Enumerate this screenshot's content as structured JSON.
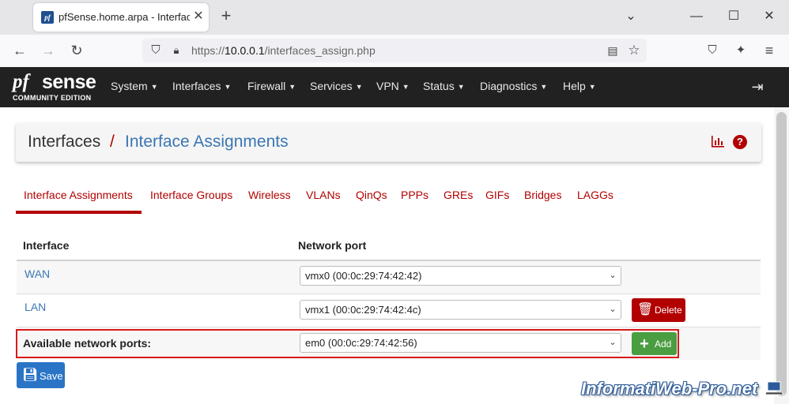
{
  "browser": {
    "tab_title": "pfSense.home.arpa - Interfaces: Interface Assignments",
    "favicon_text": "pf",
    "url_scheme": "https://",
    "url_host": "10.0.0.1",
    "url_path": "/interfaces_assign.php",
    "icons": [
      "shield-icon",
      "lock-icon",
      "reader-icon",
      "star-icon",
      "pocket-icon",
      "extensions-icon",
      "menu-icon"
    ]
  },
  "pfsense": {
    "logo_pf": "pf",
    "logo_sense": "sense",
    "edition": "COMMUNITY EDITION",
    "menu": [
      "System",
      "Interfaces",
      "Firewall",
      "Services",
      "VPN",
      "Status",
      "Diagnostics",
      "Help"
    ]
  },
  "breadcrumb": {
    "parent": "Interfaces",
    "separator": "/",
    "current": "Interface Assignments"
  },
  "tabs": [
    "Interface Assignments",
    "Interface Groups",
    "Wireless",
    "VLANs",
    "QinQs",
    "PPPs",
    "GREs",
    "GIFs",
    "Bridges",
    "LAGGs"
  ],
  "table": {
    "headers": [
      "Interface",
      "Network port"
    ],
    "rows": [
      {
        "interface": "WAN",
        "port": "vmx0 (00:0c:29:74:42:42)"
      },
      {
        "interface": "LAN",
        "port": "vmx1 (00:0c:29:74:42:4c)",
        "action": "Delete"
      }
    ],
    "available_label": "Available network ports:",
    "available_port": "em0 (00:0c:29:74:42:56)",
    "add_label": "Add"
  },
  "save_label": "Save",
  "watermark": "InformatiWeb-Pro.net",
  "colors": {
    "accent": "#b20000",
    "link": "#3a77b4",
    "add": "#4a9d40",
    "save": "#2a74c6",
    "highlight": "#d91a1a"
  }
}
